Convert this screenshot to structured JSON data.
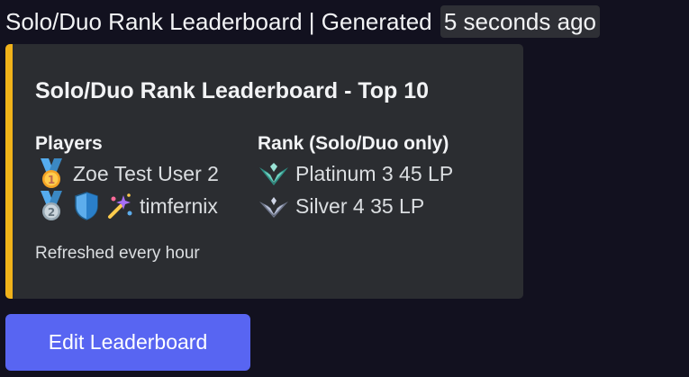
{
  "header": {
    "message": "Solo/Duo Rank Leaderboard | Generated",
    "timestamp": "5 seconds ago"
  },
  "embed": {
    "accent_color": "#f0b21a",
    "title": "Solo/Duo Rank Leaderboard - Top 10",
    "players_field": {
      "name": "Players",
      "rows": [
        {
          "medal": "gold-medal-1",
          "name": "Zoe Test User 2"
        },
        {
          "medal": "silver-medal-2",
          "badges": [
            "shield-icon",
            "sparkle-emoji-icon"
          ],
          "name": "timfernix"
        }
      ]
    },
    "rank_field": {
      "name": "Rank (Solo/Duo only)",
      "rows": [
        {
          "emblem": "platinum-emblem-icon",
          "rank": "Platinum 3 45 LP"
        },
        {
          "emblem": "silver-emblem-icon",
          "rank": "Silver 4 35 LP"
        }
      ]
    },
    "footer": "Refreshed every hour"
  },
  "actions": {
    "edit_label": "Edit Leaderboard",
    "button_color": "#5865f2"
  }
}
